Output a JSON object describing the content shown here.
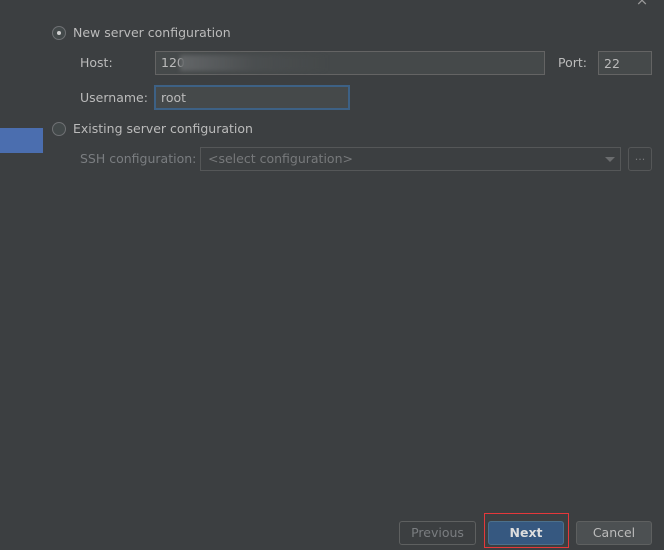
{
  "window": {
    "close_glyph": "×"
  },
  "new_server": {
    "label": "New server configuration",
    "selected": true,
    "host_label": "Host:",
    "host_value": "120",
    "port_label": "Port:",
    "port_value": "22",
    "username_label": "Username:",
    "username_value": "root"
  },
  "existing_server": {
    "label": "Existing server configuration",
    "selected": false,
    "ssh_config_label": "SSH configuration:",
    "ssh_config_placeholder": "<select configuration>",
    "browse_label": "..."
  },
  "footer": {
    "previous_label": "Previous",
    "next_label": "Next",
    "cancel_label": "Cancel"
  },
  "colors": {
    "background": "#3c3f41",
    "selection": "#4b6eaf",
    "primary_button": "#365880",
    "focus_border": "#3d6185",
    "annotation_red": "#e5383b"
  }
}
